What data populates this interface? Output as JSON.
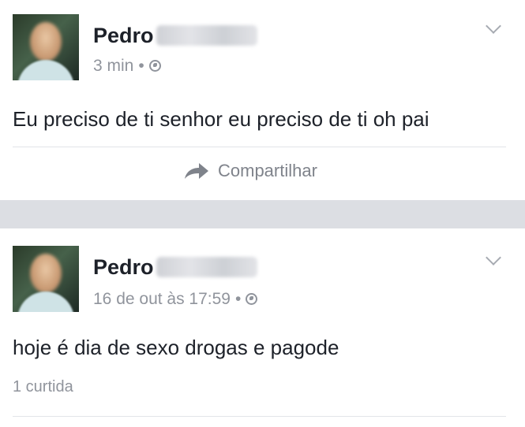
{
  "posts": [
    {
      "author": "Pedro",
      "time": "3 min",
      "separator": "•",
      "privacy_icon": "globe-icon",
      "text": "Eu preciso de ti senhor eu preciso de ti oh pai",
      "share_label": "Compartilhar",
      "share_icon": "share-arrow-icon",
      "menu_icon": "chevron-down-icon"
    },
    {
      "author": "Pedro",
      "time": "16 de out às 17:59",
      "separator": "•",
      "privacy_icon": "globe-icon",
      "text": "hoje é dia de sexo drogas e pagode",
      "likes": "1 curtida",
      "menu_icon": "chevron-down-icon"
    }
  ],
  "colors": {
    "divider_band": "#dcdee3",
    "text": "#1d2129",
    "meta": "#90949c"
  }
}
